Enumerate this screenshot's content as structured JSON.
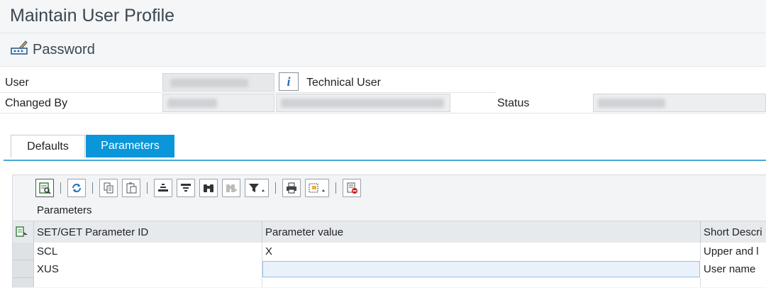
{
  "window": {
    "title": "Maintain User Profile"
  },
  "toolbar": {
    "password_label": "Password"
  },
  "header": {
    "user_label": "User",
    "technical_user_label": "Technical User",
    "changed_by_label": "Changed By",
    "status_label": "Status"
  },
  "tabs": [
    {
      "label": "Defaults",
      "active": false
    },
    {
      "label": "Parameters",
      "active": true
    }
  ],
  "grid": {
    "title": "Parameters",
    "columns": [
      "SET/GET Parameter ID",
      "Parameter value",
      "Short Descri"
    ],
    "rows": [
      {
        "id": "SCL",
        "value": "X",
        "desc": "Upper and l"
      },
      {
        "id": "XUS",
        "value": "",
        "desc": "User name"
      }
    ]
  },
  "icons": {
    "grid_toolbar": [
      "details-icon",
      "refresh-icon",
      "copy-icon",
      "paste-icon",
      "sort-ascending-icon",
      "sort-descending-icon",
      "find-icon",
      "find-next-icon",
      "filter-icon",
      "print-icon",
      "export-icon",
      "delete-row-icon"
    ]
  },
  "colors": {
    "active_tab": "#0a96d8",
    "tab_underline": "#48a9d9",
    "input_highlight": "#e9f2fb"
  }
}
